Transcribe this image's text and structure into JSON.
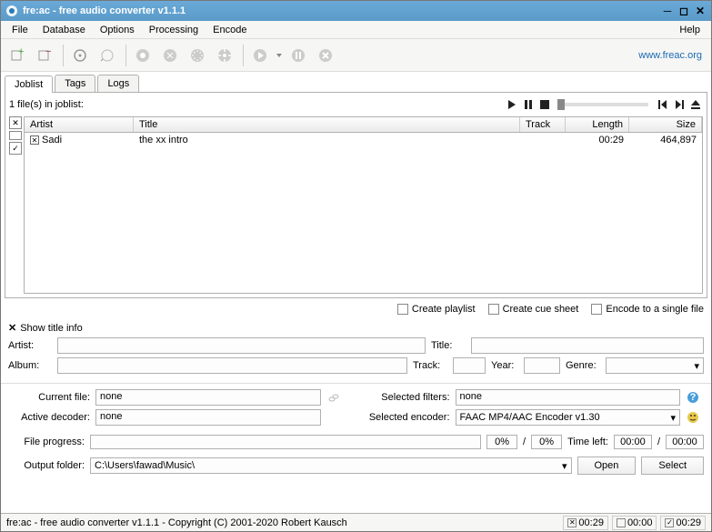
{
  "window": {
    "title": "fre:ac - free audio converter v1.1.1"
  },
  "menu": {
    "file": "File",
    "database": "Database",
    "options": "Options",
    "processing": "Processing",
    "encode": "Encode",
    "help": "Help"
  },
  "toolbar": {
    "link": "www.freac.org"
  },
  "tabs": {
    "joblist": "Joblist",
    "tags": "Tags",
    "logs": "Logs"
  },
  "joblist": {
    "count": "1 file(s) in joblist:",
    "columns": {
      "artist": "Artist",
      "title": "Title",
      "track": "Track",
      "length": "Length",
      "size": "Size"
    },
    "rows": [
      {
        "artist": "Sadi",
        "title": "the xx intro",
        "track": "",
        "length": "00:29",
        "size": "464,897"
      }
    ]
  },
  "options": {
    "playlist": "Create playlist",
    "cuesheet": "Create cue sheet",
    "singlefile": "Encode to a single file"
  },
  "titleinfo": {
    "toggle": "Show title info",
    "artist_label": "Artist:",
    "artist": "",
    "title_label": "Title:",
    "title": "",
    "album_label": "Album:",
    "album": "",
    "track_label": "Track:",
    "track": "",
    "year_label": "Year:",
    "year": "",
    "genre_label": "Genre:",
    "genre": ""
  },
  "progress": {
    "currentfile_label": "Current file:",
    "currentfile": "none",
    "selectedfilters_label": "Selected filters:",
    "selectedfilters": "none",
    "activedecoder_label": "Active decoder:",
    "activedecoder": "none",
    "selectedencoder_label": "Selected encoder:",
    "selectedencoder": "FAAC MP4/AAC Encoder v1.30",
    "fileprogress_label": "File progress:",
    "pct1": "0%",
    "pct2": "0%",
    "timeleft_label": "Time left:",
    "time1": "00:00",
    "time2": "00:00",
    "outputfolder_label": "Output folder:",
    "outputfolder": "C:\\Users\\fawad\\Music\\",
    "open": "Open",
    "select": "Select"
  },
  "status": {
    "text": "fre:ac - free audio converter v1.1.1 - Copyright (C) 2001-2020 Robert Kausch",
    "t1": "00:29",
    "t2": "00:00",
    "t3": "00:29"
  }
}
